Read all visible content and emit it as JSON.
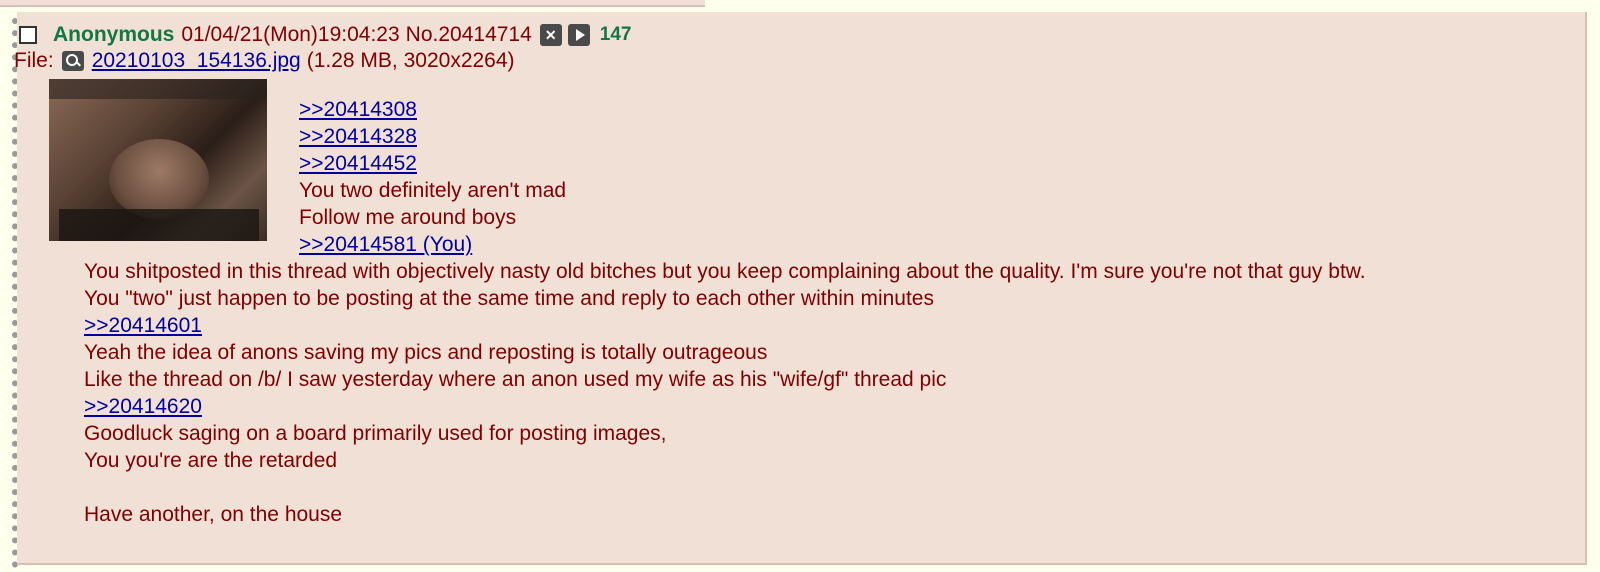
{
  "post": {
    "name": "Anonymous",
    "datetime": "01/04/21(Mon)19:04:23",
    "post_number": "No.20414714",
    "reply_count": "147",
    "file": {
      "label": "File:",
      "filename": "20210103_154136.jpg",
      "meta": "(1.28 MB, 3020x2264)"
    },
    "quotes_beside_image": [
      {
        "text": ">>20414308",
        "link": true
      },
      {
        "text": ">>20414328",
        "link": true
      },
      {
        "text": ">>20414452",
        "link": true
      },
      {
        "text": "You two definitely aren't mad",
        "link": false
      },
      {
        "text": "Follow me around boys",
        "link": false
      },
      {
        "text": ">>20414581 (You)",
        "link": true
      }
    ],
    "comment_lines": [
      {
        "text": "You shitposted in this thread with objectively nasty old bitches but you keep complaining about the quality. I'm sure you're not that guy btw.",
        "link": false
      },
      {
        "text": "You \"two\" just happen to be posting at the same time and reply to each other within minutes",
        "link": false
      },
      {
        "text": ">>20414601",
        "link": true
      },
      {
        "text": "Yeah the idea of anons saving my pics and reposting is totally outrageous",
        "link": false
      },
      {
        "text": "Like the thread on /b/ I saw yesterday where an anon used my wife as his \"wife/gf\" thread pic",
        "link": false
      },
      {
        "text": ">>20414620",
        "link": true
      },
      {
        "text": "Goodluck saging on a board primarily used for posting images,",
        "link": false
      },
      {
        "text": "You you're are the retarded",
        "link": false
      },
      {
        "text": "",
        "link": false
      },
      {
        "text": "Have another, on the house",
        "link": false
      }
    ]
  },
  "icons": {
    "hide": "close-icon",
    "play": "play-icon",
    "search": "search-icon"
  },
  "colors": {
    "post_bg": "#f0e0d6",
    "page_bg": "#ffffee",
    "text": "#800000",
    "name": "#117743",
    "link": "#0000a0"
  }
}
